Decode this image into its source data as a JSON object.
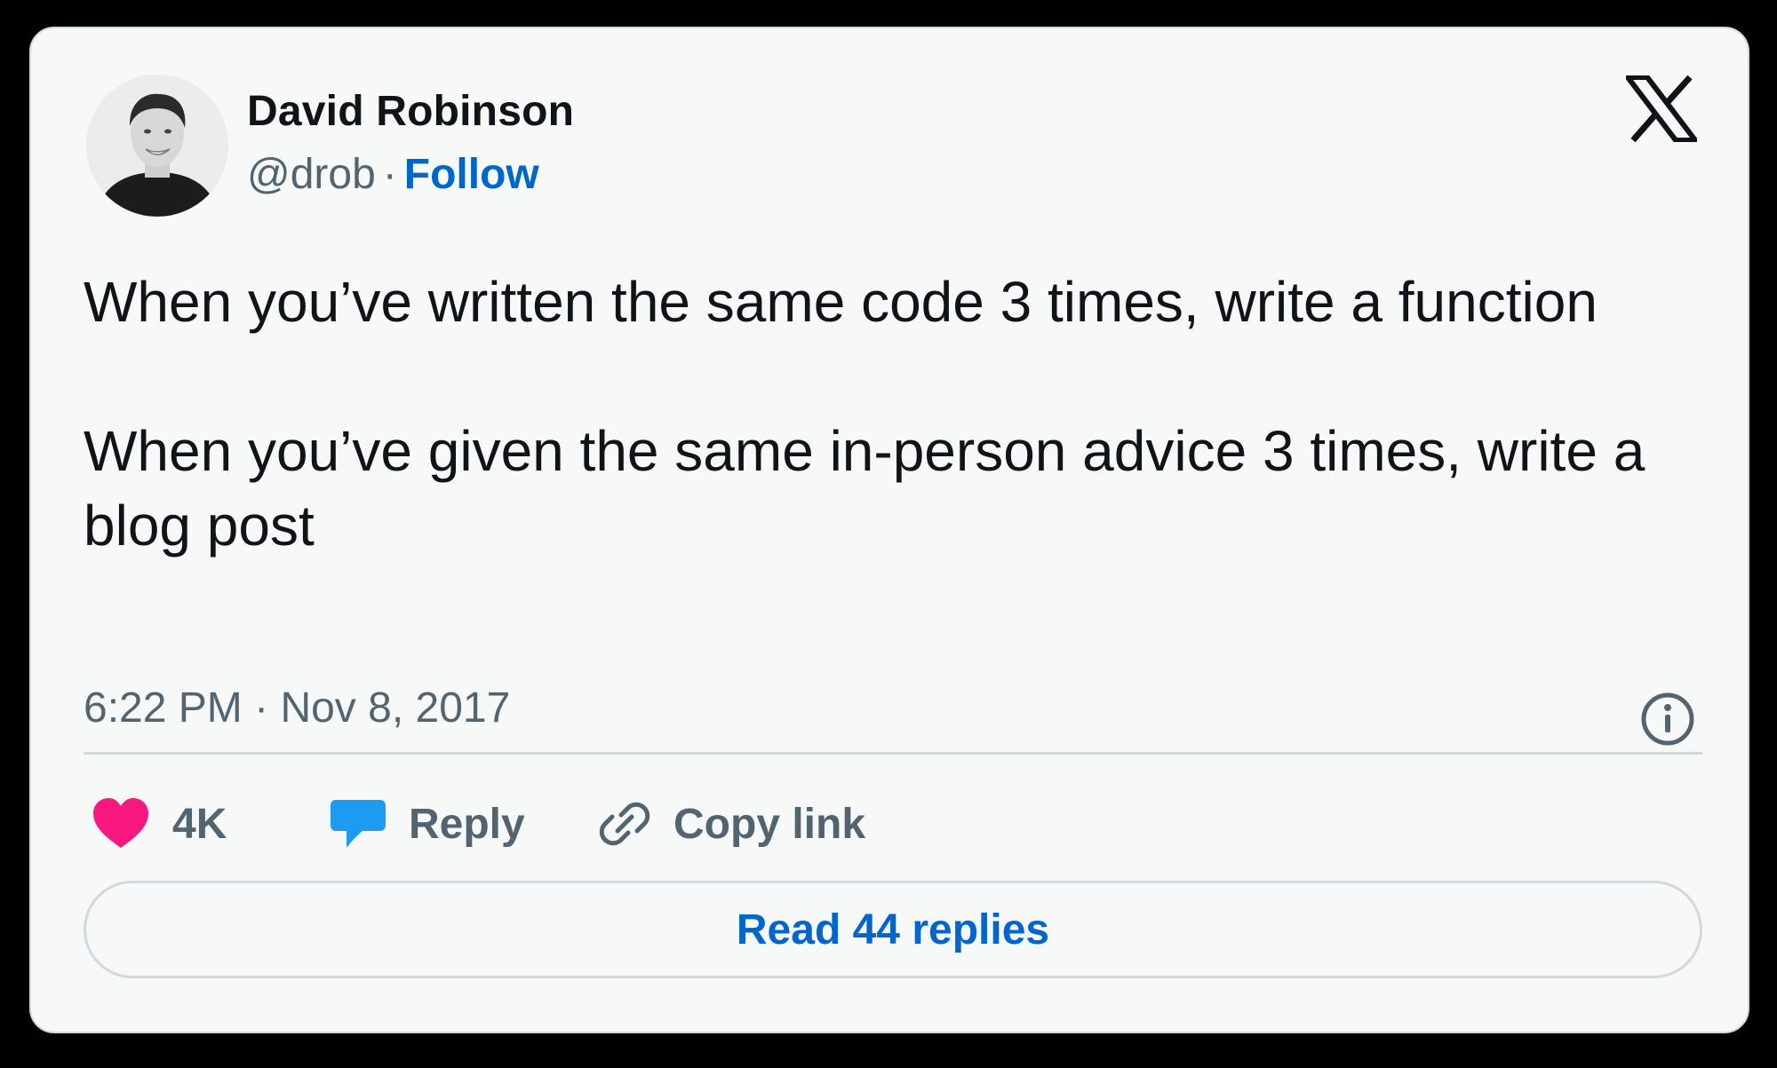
{
  "author": {
    "name": "David Robinson",
    "handle": "@drob",
    "separator": "·",
    "follow_label": "Follow"
  },
  "tweet": {
    "paragraphs": [
      "When you’ve written the same code 3 times, write a function",
      "When you’ve given the same in-person advice 3 times, write a blog post"
    ],
    "time": "6:22 PM",
    "separator": "·",
    "date": "Nov 8, 2017"
  },
  "actions": {
    "like_count": "4K",
    "reply_label": "Reply",
    "copy_link_label": "Copy link"
  },
  "read_replies_label": "Read 44 replies",
  "icons": {
    "brand": "x-logo-icon",
    "info": "info-icon",
    "like": "heart-icon",
    "reply": "speech-bubble-icon",
    "copy_link": "link-icon"
  },
  "colors": {
    "card_background": "#f7f9f9",
    "text_primary": "#0f1419",
    "text_secondary": "#536471",
    "link_blue": "#0066cc",
    "heart_pink": "#f91880",
    "reply_blue": "#1d9bf0",
    "border": "#cfd9de"
  }
}
